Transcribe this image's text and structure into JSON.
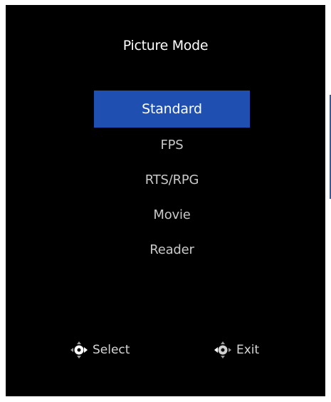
{
  "osd": {
    "title": "Picture Mode",
    "selected_index": 0,
    "items": [
      {
        "label": "Standard"
      },
      {
        "label": "FPS"
      },
      {
        "label": "RTS/RPG"
      },
      {
        "label": "Movie"
      },
      {
        "label": "Reader"
      }
    ],
    "hints": {
      "select_label": "Select",
      "select_icon": "dpad-right-icon",
      "exit_label": "Exit",
      "exit_icon": "dpad-left-icon"
    },
    "colors": {
      "background": "#000000",
      "highlight": "#1f4fb0",
      "text": "#ffffff",
      "text_dim": "#c9c9c9",
      "scroll_indicator": "#2b5db5"
    }
  }
}
